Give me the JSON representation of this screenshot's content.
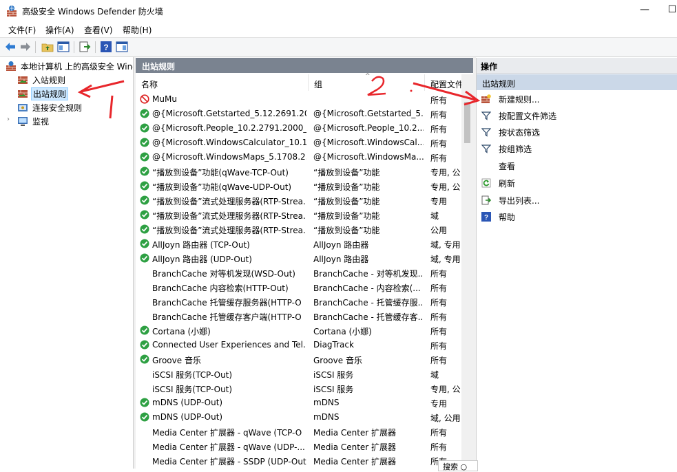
{
  "window": {
    "title": "高级安全 Windows Defender 防火墙",
    "minimize_glyph": "—",
    "maximize_glyph": "☐"
  },
  "menu": [
    {
      "label": "文件(F)"
    },
    {
      "label": "操作(A)"
    },
    {
      "label": "查看(V)"
    },
    {
      "label": "帮助(H)"
    }
  ],
  "toolbar": {
    "buttons": [
      "back-icon",
      "forward-icon",
      "up-folder-icon",
      "show-hide-tree-icon",
      "export-list-icon",
      "help-icon",
      "properties-icon"
    ]
  },
  "tree": {
    "root": "本地计算机 上的高级安全 Windows Defender 防火墙",
    "items": [
      {
        "label": "入站规则",
        "icon": "inbound-rules-icon"
      },
      {
        "label": "出站规则",
        "icon": "outbound-rules-icon",
        "selected": true
      },
      {
        "label": "连接安全规则",
        "icon": "connection-security-icon"
      },
      {
        "label": "监视",
        "icon": "monitor-icon"
      }
    ]
  },
  "rules_pane": {
    "title": "出站规则",
    "columns": [
      "名称",
      "组",
      "配置文件"
    ],
    "rows": [
      {
        "name": "MuMu",
        "group": "",
        "profile": "所有",
        "status": "blocked"
      },
      {
        "name": "@{Microsoft.Getstarted_5.12.2691.20...",
        "group": "@{Microsoft.Getstarted_5...",
        "profile": "所有",
        "status": "enabled"
      },
      {
        "name": "@{Microsoft.People_10.2.2791.2000_x...",
        "group": "@{Microsoft.People_10.2....",
        "profile": "所有",
        "status": "enabled"
      },
      {
        "name": "@{Microsoft.WindowsCalculator_10.1...",
        "group": "@{Microsoft.WindowsCal...",
        "profile": "所有",
        "status": "enabled"
      },
      {
        "name": "@{Microsoft.WindowsMaps_5.1708.2...",
        "group": "@{Microsoft.WindowsMa...",
        "profile": "所有",
        "status": "enabled"
      },
      {
        "name": "“播放到设备”功能(qWave-TCP-Out)",
        "group": "“播放到设备”功能",
        "profile": "专用, 公",
        "status": "enabled"
      },
      {
        "name": "“播放到设备”功能(qWave-UDP-Out)",
        "group": "“播放到设备”功能",
        "profile": "专用, 公",
        "status": "enabled"
      },
      {
        "name": "“播放到设备”流式处理服务器(RTP-Strea...",
        "group": "“播放到设备”功能",
        "profile": "专用",
        "status": "enabled"
      },
      {
        "name": "“播放到设备”流式处理服务器(RTP-Strea...",
        "group": "“播放到设备”功能",
        "profile": "域",
        "status": "enabled"
      },
      {
        "name": "“播放到设备”流式处理服务器(RTP-Strea...",
        "group": "“播放到设备”功能",
        "profile": "公用",
        "status": "enabled"
      },
      {
        "name": "AllJoyn 路由器 (TCP-Out)",
        "group": "AllJoyn 路由器",
        "profile": "域, 专用",
        "status": "enabled"
      },
      {
        "name": "AllJoyn 路由器 (UDP-Out)",
        "group": "AllJoyn 路由器",
        "profile": "域, 专用",
        "status": "enabled"
      },
      {
        "name": "BranchCache 对等机发现(WSD-Out)",
        "group": "BranchCache - 对等机发现...",
        "profile": "所有",
        "status": "none"
      },
      {
        "name": "BranchCache 内容检索(HTTP-Out)",
        "group": "BranchCache - 内容检索(...",
        "profile": "所有",
        "status": "none"
      },
      {
        "name": "BranchCache 托管缓存服务器(HTTP-O",
        "group": "BranchCache - 托管缓存服...",
        "profile": "所有",
        "status": "none"
      },
      {
        "name": "BranchCache 托管缓存客户端(HTTP-O",
        "group": "BranchCache - 托管缓存客...",
        "profile": "所有",
        "status": "none"
      },
      {
        "name": "Cortana (小娜)",
        "group": "Cortana (小娜)",
        "profile": "所有",
        "status": "enabled"
      },
      {
        "name": "Connected User Experiences and Tel...",
        "group": "DiagTrack",
        "profile": "所有",
        "status": "enabled"
      },
      {
        "name": "Groove 音乐",
        "group": "Groove 音乐",
        "profile": "所有",
        "status": "enabled"
      },
      {
        "name": "iSCSI 服务(TCP-Out)",
        "group": "iSCSI 服务",
        "profile": "域",
        "status": "none"
      },
      {
        "name": "iSCSI 服务(TCP-Out)",
        "group": "iSCSI 服务",
        "profile": "专用, 公",
        "status": "none"
      },
      {
        "name": "mDNS (UDP-Out)",
        "group": "mDNS",
        "profile": "专用",
        "status": "enabled"
      },
      {
        "name": "mDNS (UDP-Out)",
        "group": "mDNS",
        "profile": "域, 公用",
        "status": "enabled"
      },
      {
        "name": "Media Center 扩展器 - qWave (TCP-O",
        "group": "Media Center 扩展器",
        "profile": "所有",
        "status": "none"
      },
      {
        "name": "Media Center 扩展器 - qWave (UDP-...",
        "group": "Media Center 扩展器",
        "profile": "所有",
        "status": "none"
      },
      {
        "name": "Media Center 扩展器 - SSDP (UDP-Out)",
        "group": "Media Center 扩展器",
        "profile": "所有",
        "status": "none"
      }
    ]
  },
  "actions_pane": {
    "title": "操作",
    "section": "出站规则",
    "items": [
      {
        "label": "新建规则...",
        "icon": "new-rule-icon"
      },
      {
        "label": "按配置文件筛选",
        "icon": "filter-icon"
      },
      {
        "label": "按状态筛选",
        "icon": "filter-icon"
      },
      {
        "label": "按组筛选",
        "icon": "filter-icon"
      },
      {
        "label": "查看",
        "icon": ""
      },
      {
        "label": "刷新",
        "icon": "refresh-icon"
      },
      {
        "label": "导出列表...",
        "icon": "export-icon"
      },
      {
        "label": "帮助",
        "icon": "help-icon"
      }
    ]
  },
  "search_stub": {
    "label": "搜索 ○"
  },
  "annotations": {
    "color": "#e8262b",
    "label_1": "1",
    "label_2": "2."
  }
}
